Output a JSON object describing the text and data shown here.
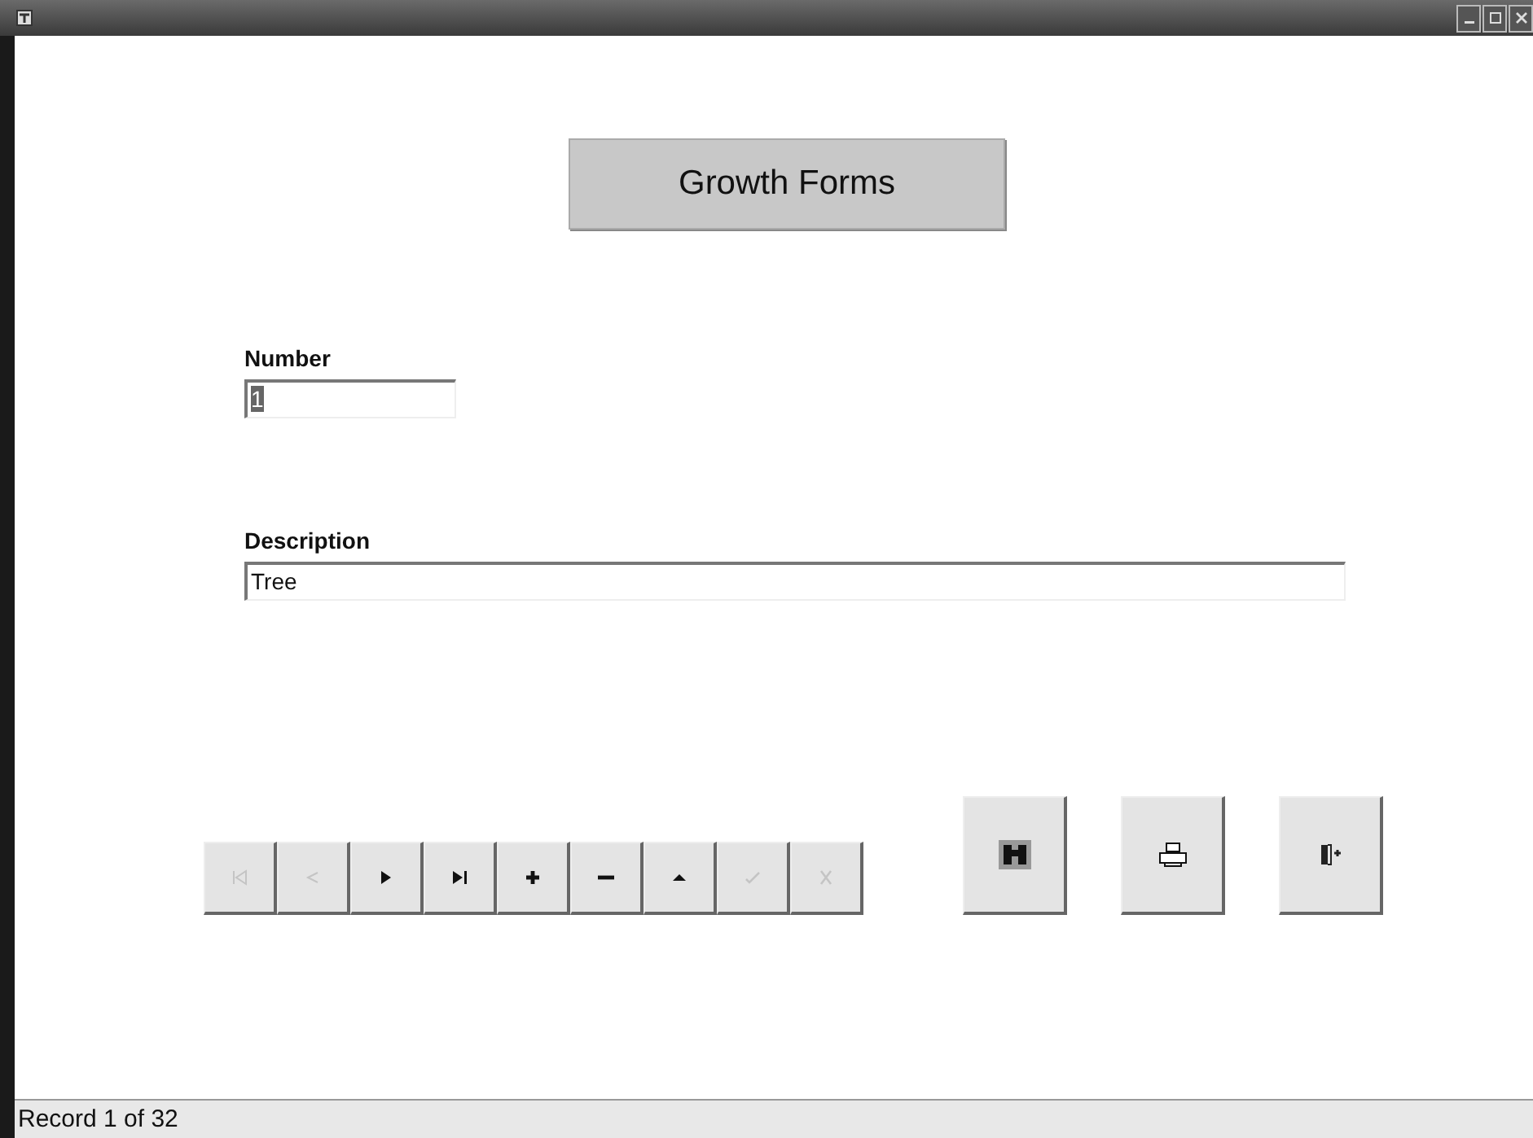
{
  "form_title": "Growth Forms",
  "fields": [
    {
      "label": "Number",
      "value": "1",
      "text_selected": true
    },
    {
      "label": "Description",
      "value": "Tree",
      "text_selected": false
    }
  ],
  "nav_buttons": [
    {
      "kind": "first",
      "disabled": true
    },
    {
      "kind": "previous",
      "disabled": true
    },
    {
      "kind": "next",
      "disabled": false
    },
    {
      "kind": "last",
      "disabled": false
    },
    {
      "kind": "add",
      "disabled": false
    },
    {
      "kind": "delete",
      "disabled": false
    },
    {
      "kind": "edit",
      "disabled": false
    },
    {
      "kind": "save",
      "disabled": true
    },
    {
      "kind": "cancel",
      "disabled": true
    }
  ],
  "action_buttons": [
    {
      "kind": "find"
    },
    {
      "kind": "print"
    },
    {
      "kind": "exit"
    }
  ],
  "status_bar": "Record 1 of 32"
}
